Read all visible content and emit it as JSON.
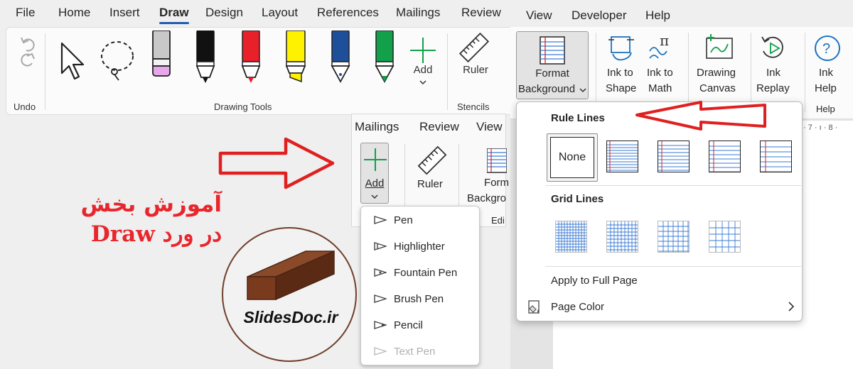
{
  "left_ribbon": {
    "tabs": [
      "File",
      "Home",
      "Insert",
      "Draw",
      "Design",
      "Layout",
      "References",
      "Mailings",
      "Review"
    ],
    "active_tab": "Draw",
    "groups": {
      "undo": "Undo",
      "drawing_tools": "Drawing Tools",
      "stencils": "Stencils"
    },
    "add_label": "Add",
    "ruler_label": "Ruler"
  },
  "mini_ribbon": {
    "tabs": [
      "Mailings",
      "Review",
      "View"
    ],
    "add_label": "Add",
    "ruler_label": "Ruler",
    "format_label_line1": "Form",
    "format_label_line2": "Backgro",
    "group_label": "Edi"
  },
  "add_menu": {
    "items": [
      {
        "label": "Pen",
        "enabled": true
      },
      {
        "label": "Highlighter",
        "enabled": true
      },
      {
        "label": "Fountain Pen",
        "enabled": true
      },
      {
        "label": "Brush Pen",
        "enabled": true
      },
      {
        "label": "Pencil",
        "enabled": true
      },
      {
        "label": "Text Pen",
        "enabled": false
      }
    ]
  },
  "right_ribbon": {
    "tabs": [
      "View",
      "Developer",
      "Help"
    ],
    "format_background": {
      "line1": "Format",
      "line2": "Background"
    },
    "ink_to_shape": {
      "line1": "Ink to",
      "line2": "Shape"
    },
    "ink_to_math": {
      "line1": "Ink to",
      "line2": "Math"
    },
    "drawing_canvas": {
      "line1": "Drawing",
      "line2": "Canvas"
    },
    "ink_replay": {
      "line1": "Ink",
      "line2": "Replay"
    },
    "ink_help": {
      "line1": "Ink",
      "line2": "Help"
    },
    "help_group": "Help",
    "ruler_text": "· 7 · ı · 8 ·"
  },
  "format_menu": {
    "rule_lines_title": "Rule Lines",
    "none_label": "None",
    "grid_lines_title": "Grid Lines",
    "apply_full_page": "Apply to Full Page",
    "page_color": "Page Color"
  },
  "overlay": {
    "persian_line1": "آموزش بخش",
    "persian_line2": "در ورد Draw",
    "logo_text": "SlidesDoc.ir"
  },
  "colors": {
    "accent_blue": "#1e5fb4",
    "arrow_red": "#e02020",
    "persian_text_red": "#e8262b",
    "logo_brown": "#6e3f2a"
  }
}
